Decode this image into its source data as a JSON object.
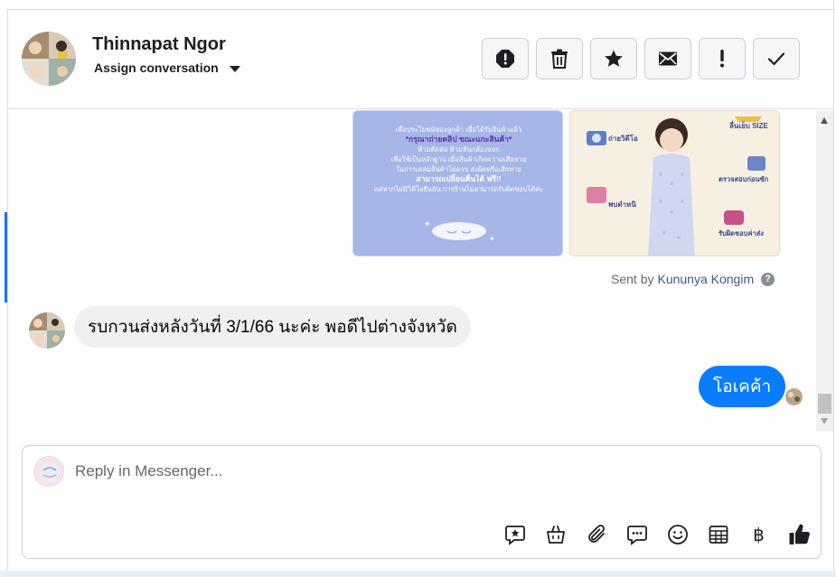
{
  "contact": {
    "name": "Thinnapat Ngor",
    "assign_label": "Assign conversation"
  },
  "actions": [
    {
      "name": "mark-spam-button",
      "icon": "alert-octagon-icon"
    },
    {
      "name": "delete-button",
      "icon": "trash-icon"
    },
    {
      "name": "star-button",
      "icon": "star-icon"
    },
    {
      "name": "mark-unread-button",
      "icon": "envelope-icon"
    },
    {
      "name": "follow-up-button",
      "icon": "exclamation-icon"
    },
    {
      "name": "mark-done-button",
      "icon": "check-icon"
    }
  ],
  "attachments": {
    "image_a_lines": [
      "เพื่อประโยชน์ของลูกค้า เมื่อได้รับสินค้าแล้ว",
      "*กรุณาถ่ายคลิป ขณะแกะสินค้า*",
      "ห้ามตัดต่อ ห้ามหันกล้องออก",
      "เพื่อใช้เป็นหลักฐาน เมื่อสินค้าเกิดความเสียหาย",
      "ในการเคลมสินค้าไม่ครบ ส่งผิดหรือเสียหาย",
      "สามารถเปลี่ยนคืนได้ ฟรี!!",
      "แต่หากไม่มีวิดีโอยืนยัน การร้านไม่สามารถรับผิดชอบได้ค่ะ"
    ],
    "image_b_labels": [
      "ถ่ายวิดีโอ",
      "ลื่นเย็บ SIZE",
      "ตรวจสอบก่อนซัก",
      "พบตำหนิ",
      "รับผิดชอบค่าส่ง"
    ]
  },
  "sent_by": {
    "prefix": "Sent by",
    "agent": "Kununya Kongim"
  },
  "messages": {
    "incoming": "รบกวนส่งหลังวันที่ 3/1/66 นะค่ะ พอดีไปต่างจังหวัด",
    "outgoing": "โอเคค้า"
  },
  "composer": {
    "placeholder": "Reply in Messenger...",
    "tools": [
      "saved-reply-icon",
      "shopping-bag-icon",
      "paperclip-icon",
      "chat-dots-icon",
      "emoji-icon",
      "calendar-grid-icon",
      "baht-icon",
      "thumbs-up-icon"
    ],
    "baht_symbol": "฿"
  },
  "colors": {
    "accent": "#1877f2",
    "outgoing_bubble": "#0a7cff",
    "incoming_bubble": "#f0f0f0"
  }
}
